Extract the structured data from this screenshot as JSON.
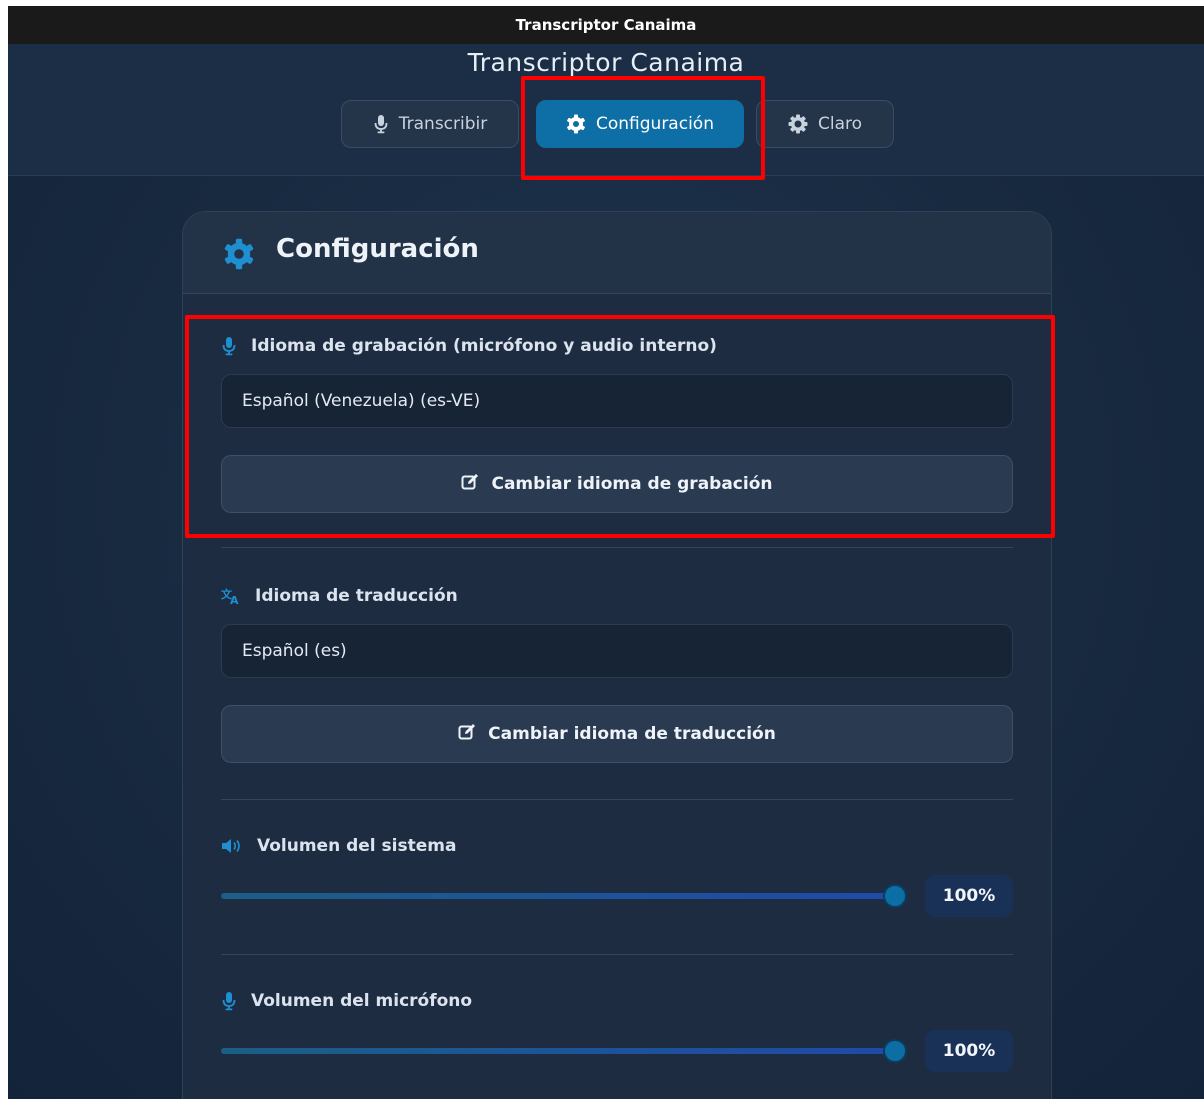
{
  "window": {
    "title": "Transcriptor Canaima"
  },
  "header": {
    "title": "Transcriptor Canaima",
    "tabs": [
      {
        "label": "Transcribir",
        "icon": "microphone-icon",
        "active": false
      },
      {
        "label": "Configuración",
        "icon": "gear-icon",
        "active": true
      },
      {
        "label": "Claro",
        "icon": "sun-gear-icon",
        "active": false
      }
    ]
  },
  "panel": {
    "title": "Configuración",
    "icon": "gear-icon",
    "recording_language": {
      "label": "Idioma de grabación (micrófono y audio interno)",
      "icon": "microphone-icon",
      "value": "Español (Venezuela) (es-VE)",
      "button_label": "Cambiar idioma de grabación",
      "button_icon": "edit-icon"
    },
    "translation_language": {
      "label": "Idioma de traducción",
      "icon": "translate-icon",
      "value": "Español (es)",
      "button_label": "Cambiar idioma de traducción",
      "button_icon": "edit-icon"
    },
    "system_volume": {
      "label": "Volumen del sistema",
      "icon": "speaker-icon",
      "value": 1.0,
      "display": "100%"
    },
    "mic_volume": {
      "label": "Volumen del micrófono",
      "icon": "microphone-icon",
      "value": 1.0,
      "display": "100%"
    }
  },
  "colors": {
    "accent": "#0e6fa6",
    "highlight": "#ff0000",
    "background": "#182a40",
    "card": "#1d2c40"
  }
}
